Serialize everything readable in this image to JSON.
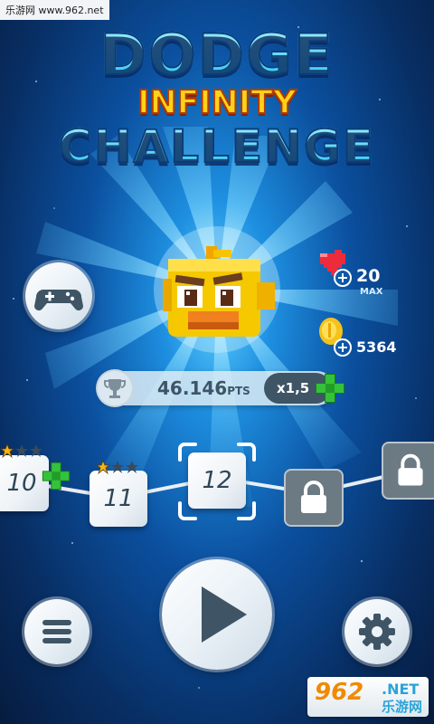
{
  "watermark": {
    "site": "乐游网 www.962.net",
    "badge_main": "962",
    "badge_net": ".NET",
    "badge_sub": "乐游网"
  },
  "title": {
    "line1": "DODGE",
    "line2": "INFINITY",
    "line3": "CHALLENGE"
  },
  "stats": {
    "lives_value": "20",
    "lives_caption": "MAX",
    "coins_value": "5364"
  },
  "score": {
    "value": "46.146",
    "unit": "PTS",
    "multiplier": "x1,5"
  },
  "levels": [
    {
      "number": "10",
      "stars_earned": 1,
      "stars_total": 3,
      "state": "unlocked"
    },
    {
      "number": "11",
      "stars_earned": 1,
      "stars_total": 3,
      "state": "unlocked"
    },
    {
      "number": "12",
      "stars_earned": 0,
      "stars_total": 3,
      "state": "selected"
    },
    {
      "state": "locked"
    },
    {
      "state": "locked"
    }
  ],
  "icons": {
    "gamepad": "gamepad-icon",
    "heart": "heart-icon",
    "coin": "coin-icon",
    "trophy": "trophy-icon",
    "plus": "green-plus-icon",
    "play": "play-icon",
    "menu": "hamburger-menu-icon",
    "settings": "gear-icon",
    "lock": "lock-icon",
    "star": "star-icon"
  },
  "colors": {
    "accent_cyan": "#2cc4f4",
    "title_yellow": "#ffd21a",
    "button_dark": "#3f5565",
    "plus_green": "#22a82a",
    "heart_red": "#ee2b3b",
    "coin_gold": "#f4c21a",
    "star_gold": "#f6b416"
  }
}
